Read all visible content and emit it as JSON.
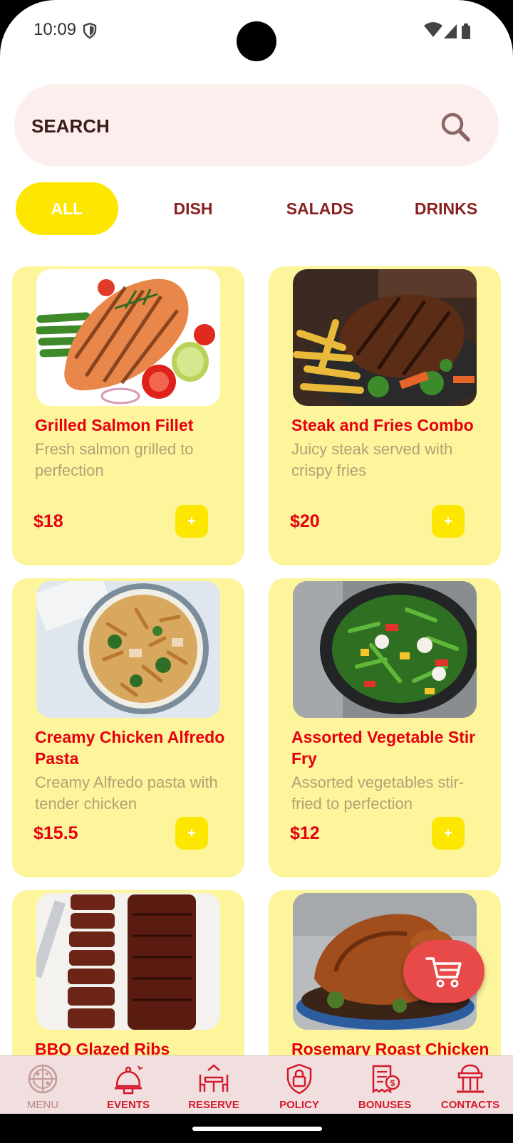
{
  "status": {
    "time": "10:09"
  },
  "search": {
    "label": "SEARCH"
  },
  "tabs": [
    {
      "label": "ALL",
      "active": true
    },
    {
      "label": "DISH",
      "active": false
    },
    {
      "label": "SALADS",
      "active": false
    },
    {
      "label": "DRINKS",
      "active": false
    }
  ],
  "menu": [
    {
      "title": "Grilled Salmon Fillet",
      "desc": "Fresh salmon grilled to perfection",
      "price": "$18",
      "add": "+"
    },
    {
      "title": "Steak and Fries Combo",
      "desc": "Juicy steak served with crispy fries",
      "price": "$20",
      "add": "+"
    },
    {
      "title": "Creamy Chicken Alfredo Pasta",
      "desc": "Creamy Alfredo pasta with tender chicken",
      "price": "$15.5",
      "add": "+"
    },
    {
      "title": "Assorted Vegetable Stir Fry",
      "desc": "Assorted vegetables stir-fried to perfection",
      "price": "$12",
      "add": "+"
    },
    {
      "title": "BBQ Glazed Ribs",
      "desc": "",
      "price": "",
      "add": ""
    },
    {
      "title": "Rosemary Roast Chicken",
      "desc": "",
      "price": "",
      "add": ""
    }
  ],
  "nav": [
    {
      "label": "MENU",
      "icon": "pizza-icon",
      "active": true
    },
    {
      "label": "EVENTS",
      "icon": "cloche-icon",
      "active": false
    },
    {
      "label": "RESERVE",
      "icon": "table-icon",
      "active": false
    },
    {
      "label": "POLICY",
      "icon": "lock-shield-icon",
      "active": false
    },
    {
      "label": "BONUSES",
      "icon": "receipt-dollar-icon",
      "active": false
    },
    {
      "label": "CONTACTS",
      "icon": "building-icon",
      "active": false
    }
  ],
  "colors": {
    "accent_yellow": "#fde600",
    "card_bg": "#fdf59b",
    "title_red": "#e60012",
    "search_bg": "#fdeeee",
    "nav_bg": "#f1dfe0",
    "fab_red": "#e84a4a"
  }
}
